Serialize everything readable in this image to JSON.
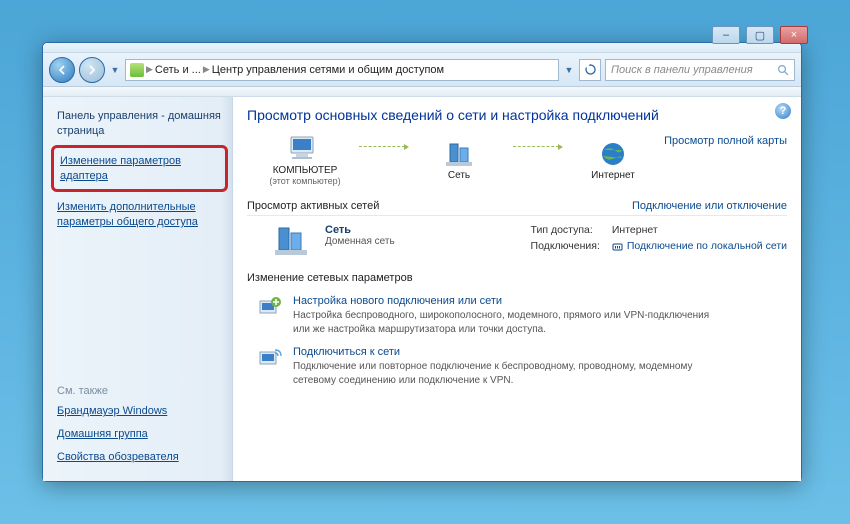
{
  "window": {
    "min": "–",
    "max": "▢",
    "close": "×"
  },
  "addrbar": {
    "crumb1": "Сеть и ...",
    "crumb2": "Центр управления сетями и общим доступом",
    "search_placeholder": "Поиск в панели управления"
  },
  "sidebar": {
    "home_title": "Панель управления - домашняя страница",
    "adapter_link": "Изменение параметров адаптера",
    "sharing_link": "Изменить дополнительные параметры общего доступа",
    "see_also": "См. также",
    "firewall": "Брандмауэр Windows",
    "homegroup": "Домашняя группа",
    "inetopts": "Свойства обозревателя"
  },
  "main": {
    "heading": "Просмотр основных сведений о сети и настройка подключений",
    "full_map": "Просмотр полной карты",
    "map": {
      "node1": "КОМПЬЮТЕР",
      "node1_sub": "(этот компьютер)",
      "node2": "Сеть",
      "node3": "Интернет"
    },
    "active_hdr": "Просмотр активных сетей",
    "connect_disconnect": "Подключение или отключение",
    "network": {
      "name": "Сеть",
      "type": "Доменная сеть",
      "access_label": "Тип доступа:",
      "access_value": "Интернет",
      "conn_label": "Подключения:",
      "conn_value": "Подключение по локальной сети"
    },
    "change_hdr": "Изменение сетевых параметров",
    "items": [
      {
        "title": "Настройка нового подключения или сети",
        "desc": "Настройка беспроводного, широкополосного, модемного, прямого или VPN-подключения или же настройка маршрутизатора или точки доступа."
      },
      {
        "title": "Подключиться к сети",
        "desc": "Подключение или повторное подключение к беспроводному, проводному, модемному сетевому соединению или подключение к VPN."
      }
    ]
  }
}
